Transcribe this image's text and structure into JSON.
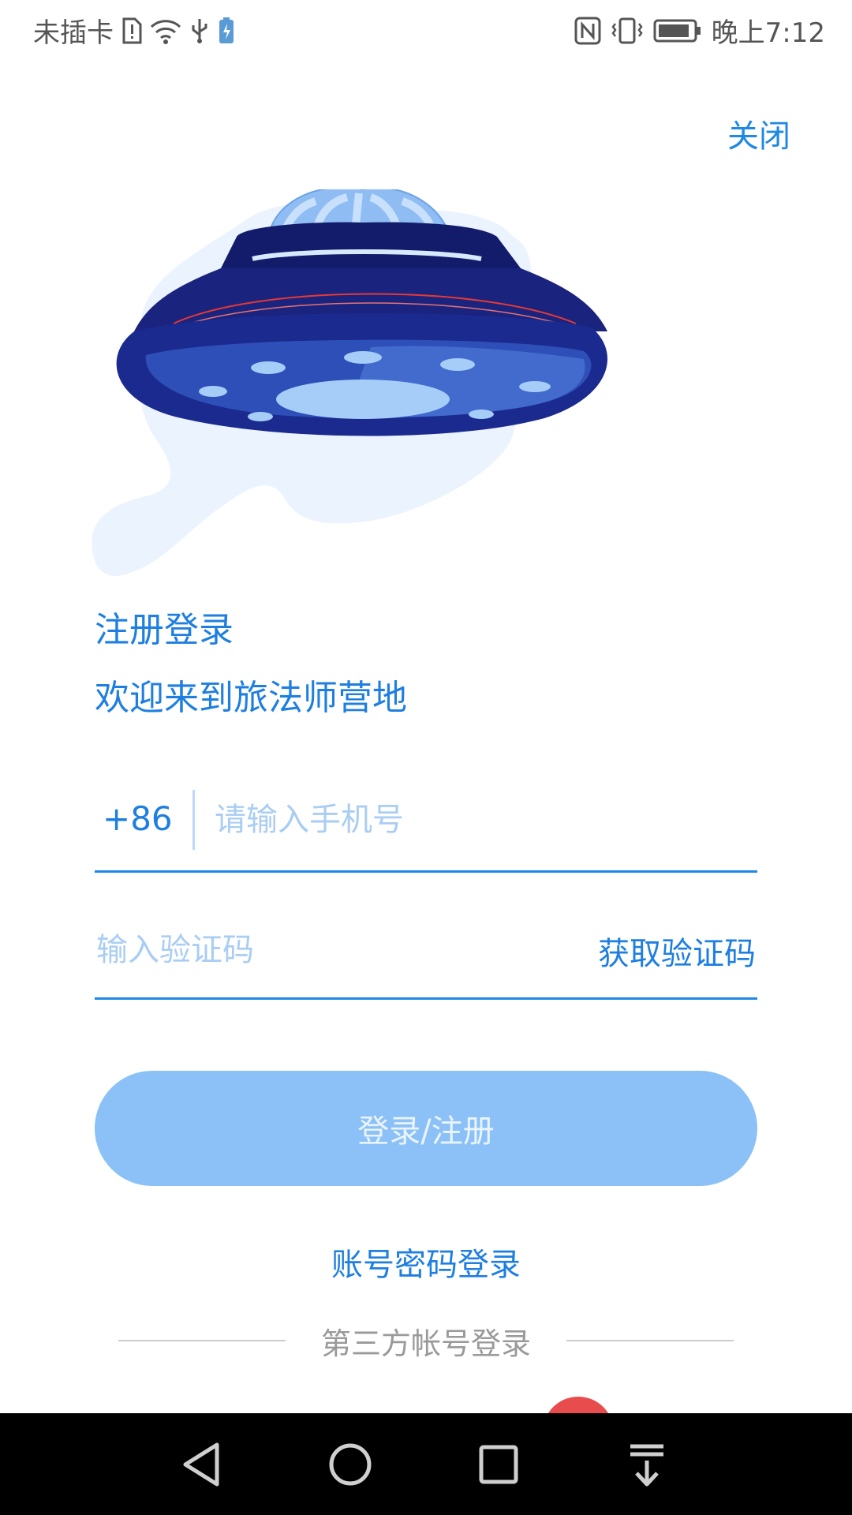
{
  "status_bar": {
    "carrier": "未插卡",
    "time": "晚上7:12",
    "icons": [
      "sim-alert-icon",
      "wifi-icon",
      "usb-icon",
      "charging-icon",
      "nfc-icon",
      "vibrate-icon",
      "battery-icon"
    ]
  },
  "header": {
    "close_label": "关闭"
  },
  "titles": {
    "line1": "注册登录",
    "line2": "欢迎来到旅法师营地"
  },
  "phone": {
    "country_code": "+86",
    "placeholder": "请输入手机号",
    "value": ""
  },
  "verification": {
    "placeholder": "输入验证码",
    "value": "",
    "get_code_label": "获取验证码"
  },
  "login_button_label": "登录/注册",
  "password_login_label": "账号密码登录",
  "third_party_label": "第三方帐号登录",
  "nav_bar": {
    "icons": [
      "back-icon",
      "home-icon",
      "recents-icon",
      "notification-pull-icon"
    ]
  },
  "colors": {
    "accent": "#1e88e5",
    "button": "#8bc1f6",
    "placeholder": "#a9cdf3",
    "ufo_dark": "#1a237e",
    "ufo_light": "#a5cdf8"
  }
}
